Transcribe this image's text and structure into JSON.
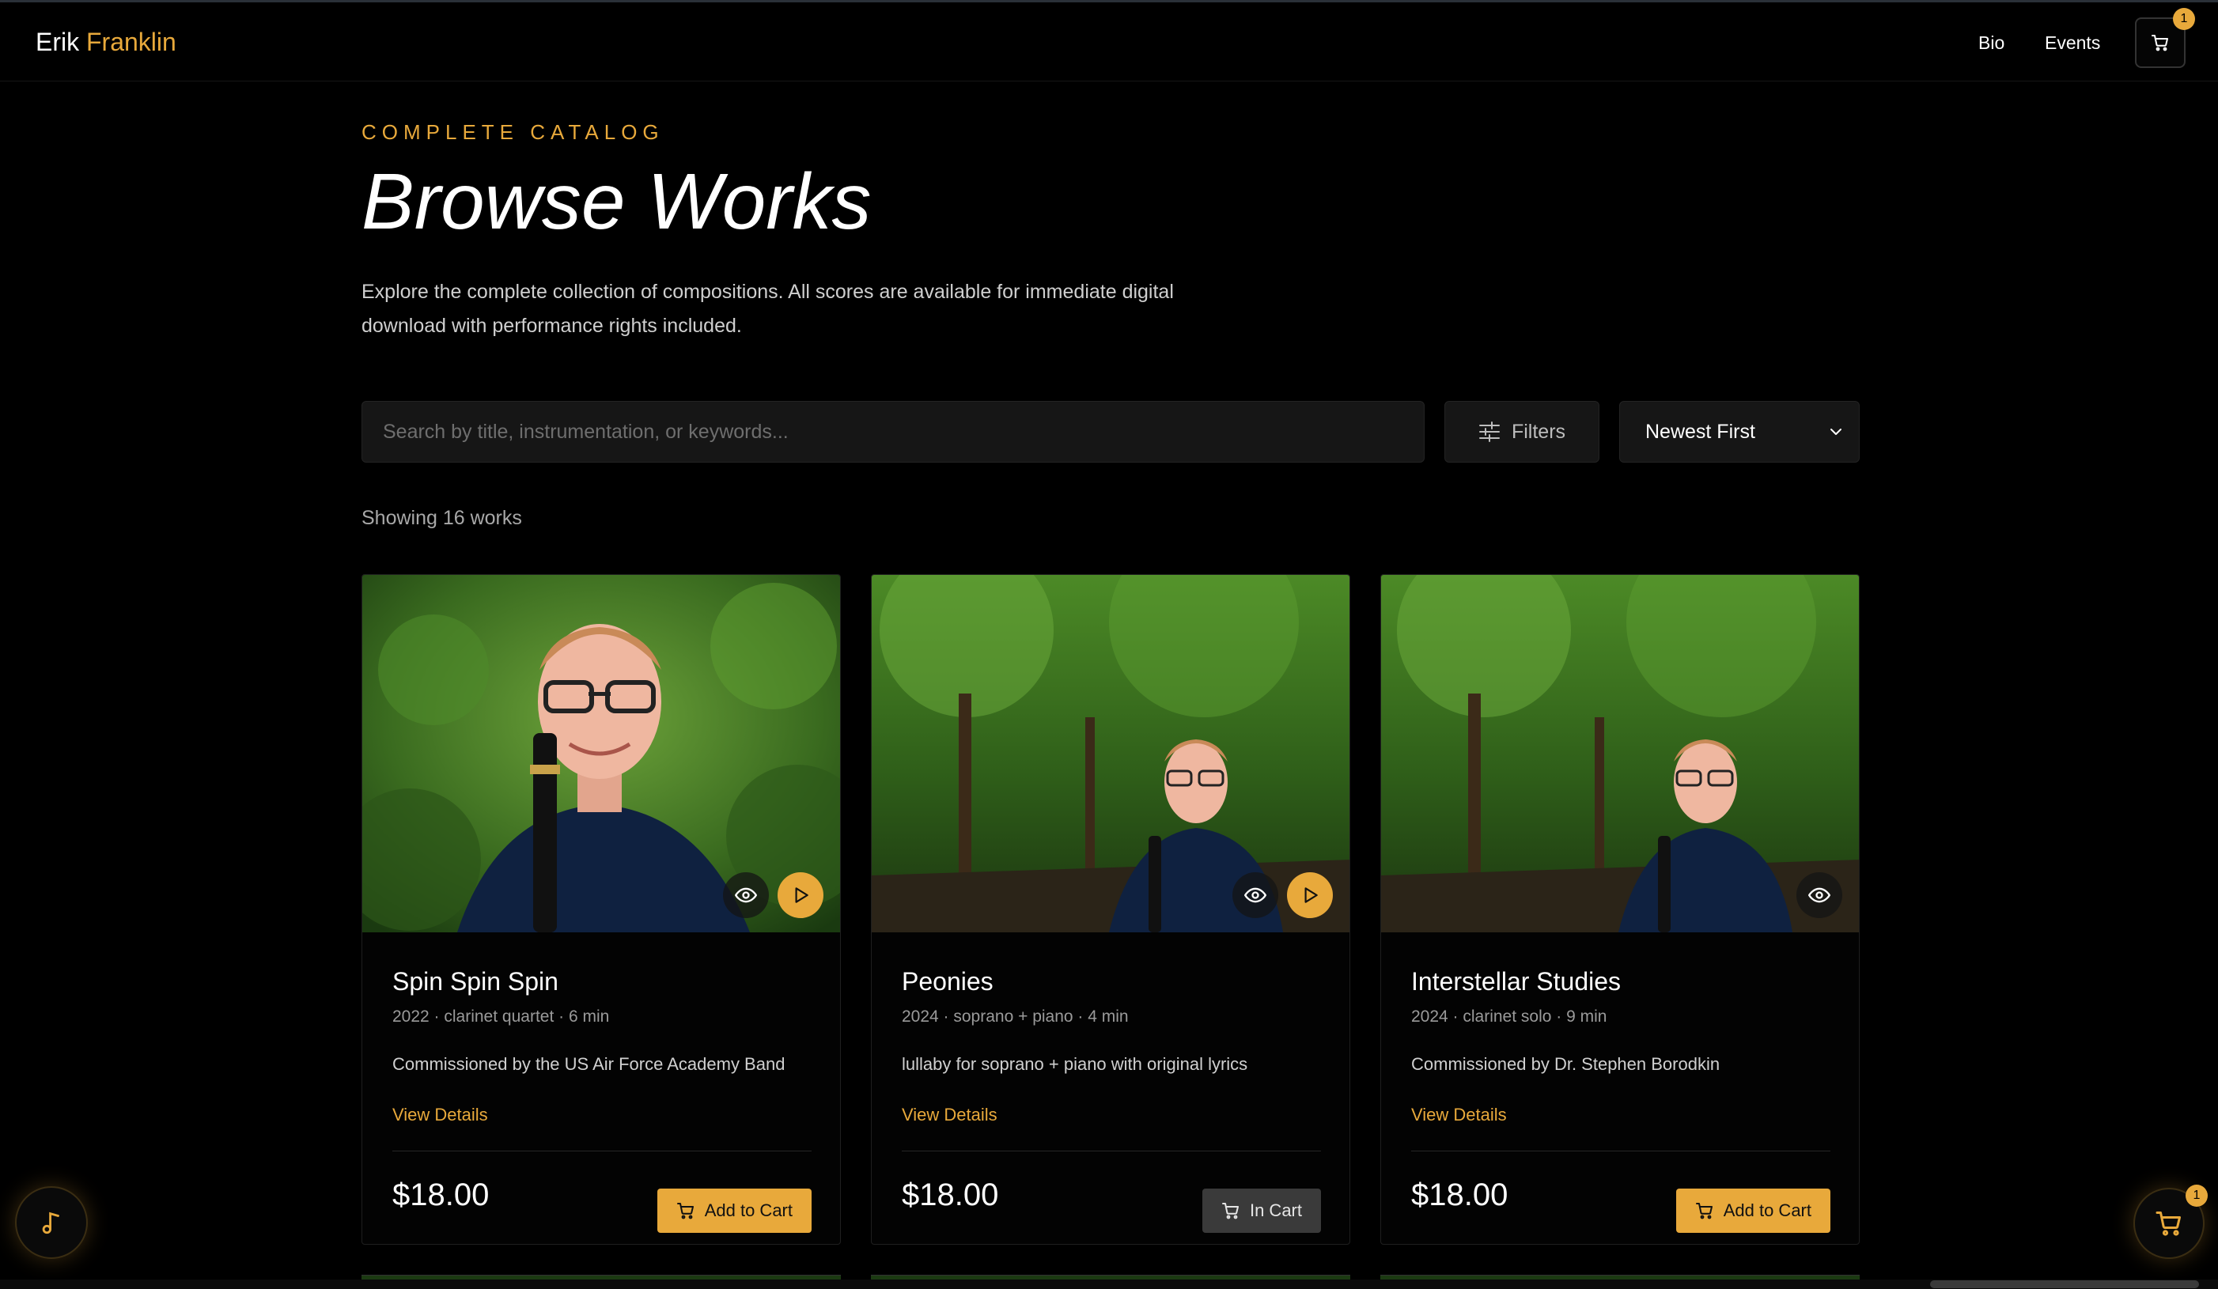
{
  "nav": {
    "brand_first": "Erik",
    "brand_last": "Franklin",
    "links": [
      {
        "label": "Bio"
      },
      {
        "label": "Events"
      }
    ],
    "cart_count": "1"
  },
  "header": {
    "eyebrow": "COMPLETE CATALOG",
    "title": "Browse Works",
    "description": "Explore the complete collection of compositions. All scores are available for immediate digital download with performance rights included."
  },
  "controls": {
    "search_placeholder": "Search by title, instrumentation, or keywords...",
    "search_value": "",
    "filters_label": "Filters",
    "sort_selected": "Newest First"
  },
  "results": {
    "count_text": "Showing 16 works"
  },
  "works": [
    {
      "title": "Spin Spin Spin",
      "meta": "2022 · clarinet quartet · 6 min",
      "description": "Commissioned by the US Air Force Academy Band",
      "link": "View Details",
      "price": "$18.00",
      "cart_label": "Add to Cart",
      "in_cart": false,
      "has_audio": true
    },
    {
      "title": "Peonies",
      "meta": "2024 · soprano + piano · 4 min",
      "description": "lullaby for soprano + piano with original lyrics",
      "link": "View Details",
      "price": "$18.00",
      "cart_label": "In Cart",
      "in_cart": true,
      "has_audio": true
    },
    {
      "title": "Interstellar Studies",
      "meta": "2024 · clarinet solo · 9 min",
      "description": "Commissioned by Dr. Stephen Borodkin",
      "link": "View Details",
      "price": "$18.00",
      "cart_label": "Add to Cart",
      "in_cart": false,
      "has_audio": false
    }
  ],
  "floating": {
    "music_icon": "music-note-icon",
    "cart_count": "1"
  },
  "colors": {
    "accent": "#e8a93b",
    "background": "#000000",
    "surface": "#161616"
  }
}
